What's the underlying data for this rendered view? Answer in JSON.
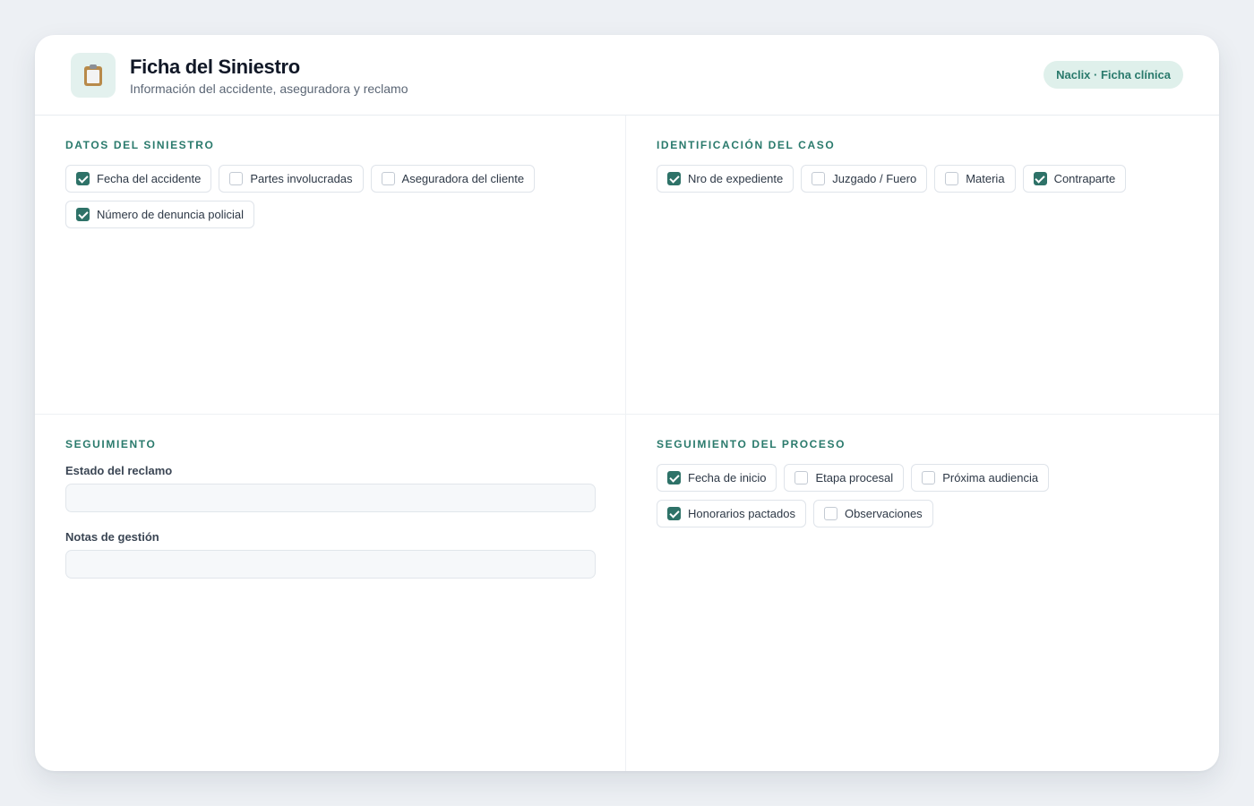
{
  "header": {
    "title": "Ficha del Siniestro",
    "subtitle": "Información del accidente, aseguradora y reclamo",
    "badge": "Naclix · Ficha clínica",
    "icon": "clipboard-icon"
  },
  "sections": {
    "datos": {
      "title": "DATOS DEL SINIESTRO",
      "items": [
        {
          "label": "Fecha del accidente",
          "checked": true
        },
        {
          "label": "Partes involucradas",
          "checked": false
        },
        {
          "label": "Aseguradora del cliente",
          "checked": false
        },
        {
          "label": "Número de denuncia policial",
          "checked": true
        }
      ]
    },
    "identificacion": {
      "title": "IDENTIFICACIÓN DEL CASO",
      "items": [
        {
          "label": "Nro de expediente",
          "checked": true
        },
        {
          "label": "Juzgado / Fuero",
          "checked": false
        },
        {
          "label": "Materia",
          "checked": false
        },
        {
          "label": "Contraparte",
          "checked": true
        }
      ]
    },
    "seguimiento": {
      "title": "SEGUIMIENTO",
      "fields": [
        {
          "label": "Estado del reclamo",
          "value": ""
        },
        {
          "label": "Notas de gestión",
          "value": ""
        }
      ]
    },
    "proceso": {
      "title": "SEGUIMIENTO DEL PROCESO",
      "items": [
        {
          "label": "Fecha de inicio",
          "checked": true
        },
        {
          "label": "Etapa procesal",
          "checked": false
        },
        {
          "label": "Próxima audiencia",
          "checked": false
        },
        {
          "label": "Honorarios pactados",
          "checked": true
        },
        {
          "label": "Observaciones",
          "checked": false
        }
      ]
    }
  },
  "colors": {
    "accent": "#2e7268",
    "accent_text": "#2a7a6c",
    "badge_bg": "#dff0eb",
    "page_bg": "#edf0f4"
  }
}
